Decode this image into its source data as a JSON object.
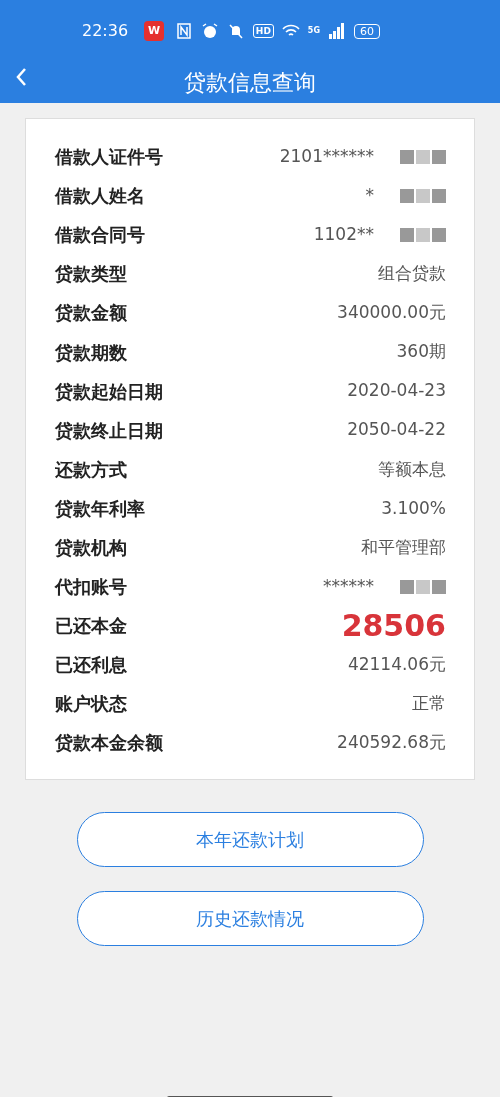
{
  "status_bar": {
    "time": "22:36",
    "app_badge": "W",
    "hd": "HD",
    "network": "5G",
    "battery": "60"
  },
  "header": {
    "title": "贷款信息查询"
  },
  "rows": [
    {
      "label": "借款人证件号",
      "value": "2101******",
      "masked": true
    },
    {
      "label": "借款人姓名",
      "value": "*",
      "masked": true
    },
    {
      "label": "借款合同号",
      "value": "1102**",
      "masked": true
    },
    {
      "label": "贷款类型",
      "value": "组合贷款"
    },
    {
      "label": "贷款金额",
      "value": "340000.00元"
    },
    {
      "label": "贷款期数",
      "value": "360期"
    },
    {
      "label": "贷款起始日期",
      "value": "2020-04-23"
    },
    {
      "label": "贷款终止日期",
      "value": "2050-04-22"
    },
    {
      "label": "还款方式",
      "value": "等额本息"
    },
    {
      "label": "贷款年利率",
      "value": "3.100%"
    },
    {
      "label": "贷款机构",
      "value": "和平管理部"
    },
    {
      "label": "代扣账号",
      "value": "******",
      "masked": true
    },
    {
      "label": "已还本金",
      "value": "28506",
      "emphasis": true
    },
    {
      "label": "已还利息",
      "value": "42114.06元"
    },
    {
      "label": "账户状态",
      "value": "正常"
    },
    {
      "label": "贷款本金余额",
      "value": "240592.68元"
    }
  ],
  "buttons": [
    "本年还款计划",
    "历史还款情况"
  ]
}
